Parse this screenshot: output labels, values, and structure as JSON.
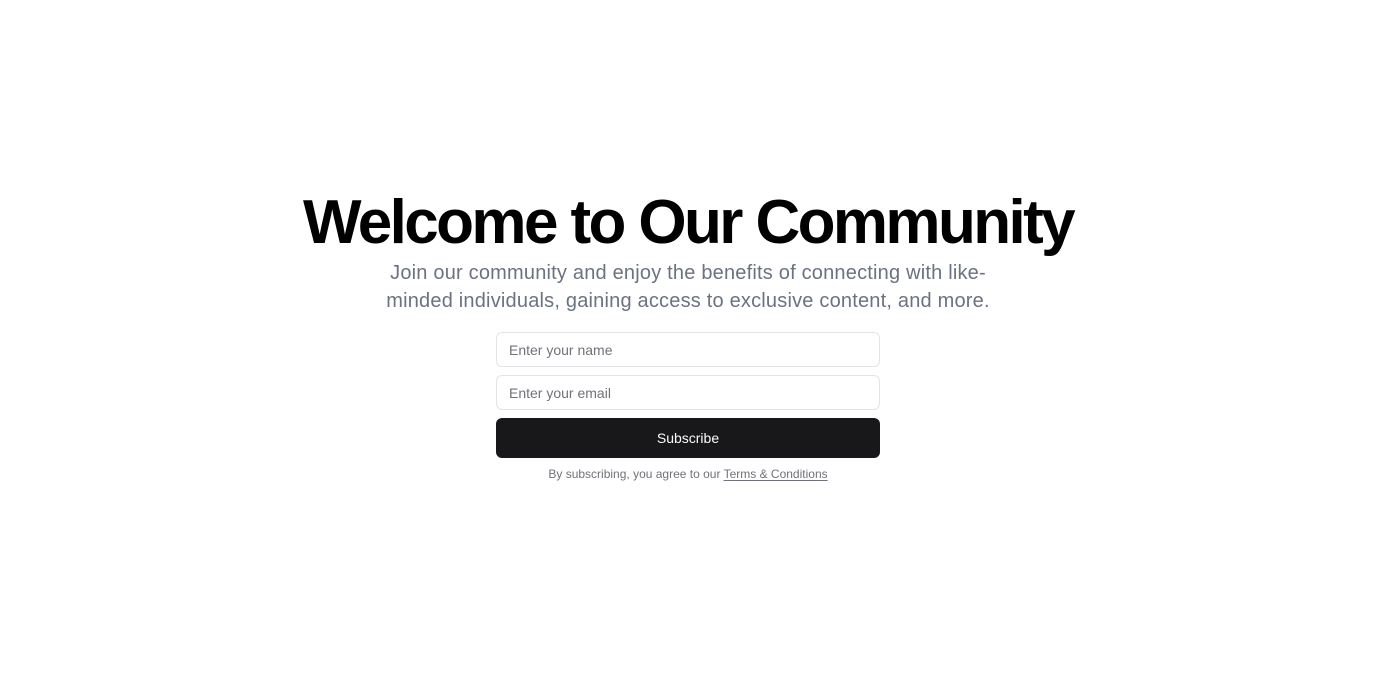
{
  "hero": {
    "title": "Welcome to Our Community",
    "subtitle": "Join our community and enjoy the benefits of connecting with like-minded individuals, gaining access to exclusive content, and more."
  },
  "form": {
    "name_placeholder": "Enter your name",
    "name_value": "",
    "email_placeholder": "Enter your email",
    "email_value": "",
    "subscribe_label": "Subscribe",
    "terms_prefix": "By subscribing, you agree to our ",
    "terms_link": "Terms & Conditions"
  },
  "colors": {
    "background": "#ffffff",
    "title": "#000000",
    "subtitle": "#6b7280",
    "button_bg": "#18181b",
    "button_text": "#fafafa",
    "border": "#e4e4e7",
    "muted": "#71717a"
  }
}
